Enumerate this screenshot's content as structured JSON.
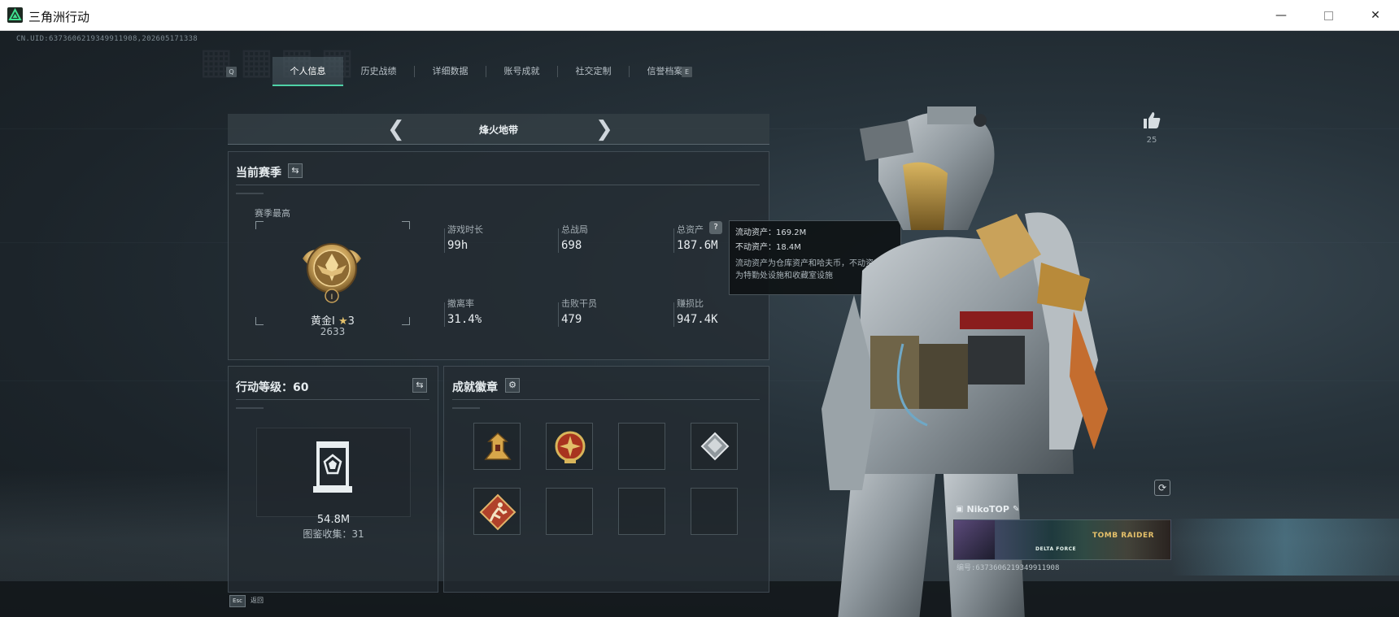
{
  "window": {
    "title": "三角洲行动",
    "controls": {
      "minimize": "—",
      "maximize": "",
      "close": "✕"
    }
  },
  "game": {
    "uid": "CN.UID:6373606219349911908,202605171338",
    "tabs": [
      {
        "label": "个人信息",
        "active": true
      },
      {
        "label": "历史战绩",
        "active": false
      },
      {
        "label": "详细数据",
        "active": false
      },
      {
        "label": "账号成就",
        "active": false
      },
      {
        "label": "社交定制",
        "active": false
      },
      {
        "label": "信誉档案",
        "active": false
      }
    ],
    "tab_prev_key": "Q",
    "tab_next_key": "E",
    "mode": {
      "title": "烽火地带",
      "prev_icon": "chevron-left-icon",
      "next_icon": "chevron-right-icon"
    },
    "season": {
      "title": "当前赛季",
      "switch_icon": "swap-icon",
      "best_label": "赛季最高",
      "rank_name": "黄金I",
      "rank_stars": "3",
      "rank_points": "2633"
    },
    "stats": [
      {
        "label": "游戏时长",
        "value": "99h"
      },
      {
        "label": "总战局",
        "value": "698"
      },
      {
        "label": "总资产",
        "value": "187.6M"
      },
      {
        "label": "撤离率",
        "value": "31.4%"
      },
      {
        "label": "击败干员",
        "value": "479"
      },
      {
        "label": "赚损比",
        "value": "947.4K"
      }
    ],
    "help_icon_text": "?",
    "tooltip": {
      "liquid": "流动资产：169.2M",
      "fixed": "不动资产：18.4M",
      "desc_line1": "流动资产为仓库资产和哈夫币，不动资产",
      "desc_line2": "为特勤处设施和收藏室设施"
    },
    "level": {
      "title": "行动等级：60",
      "collection_value": "54.8M",
      "collection_count": "图鉴收集：31"
    },
    "badges": {
      "title": "成就徽章",
      "settings_icon": "gear-icon",
      "slots": [
        "badge-tower",
        "badge-cross-medal",
        "",
        "badge-cube",
        "badge-runner",
        "",
        "",
        ""
      ]
    },
    "character": {
      "likes": "25",
      "player_name": "NikoTOP",
      "banner_brand": "DELTA FORCE",
      "banner_collab": "TOMB RAIDER",
      "uid_line": "编号:6373606219349911908"
    },
    "footer": {
      "esc_key": "Esc",
      "esc_label": "返回"
    },
    "colors": {
      "accent": "#4fd1a7",
      "panel": "#242c32",
      "gold": "#c9a25a"
    }
  }
}
